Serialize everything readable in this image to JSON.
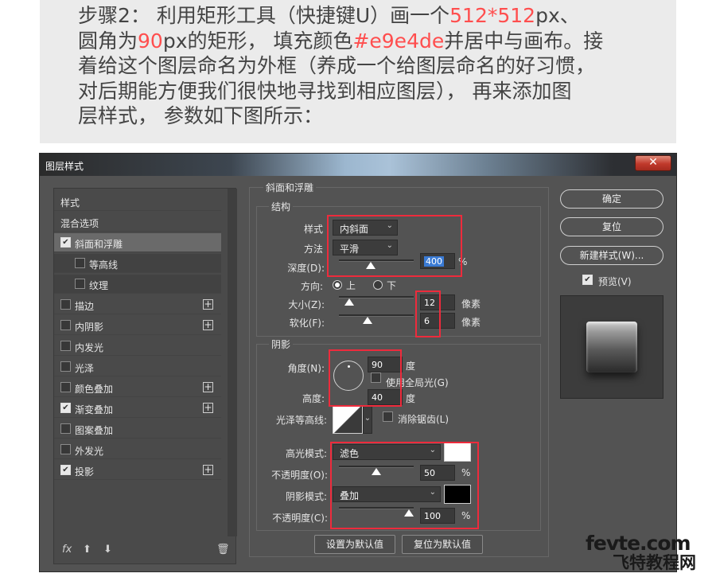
{
  "intro": {
    "line1_a": "步骤2：  利用矩形工具（快捷键U）画一个",
    "line1_hl": "512*512",
    "line1_b": "px、",
    "line2_a": "圆角为",
    "line2_hl1": "90",
    "line2_b": "px的矩形，  填充颜色",
    "line2_hl2": "#e9e4de",
    "line2_c": "并居中与画布。接",
    "line3": "着给这个图层命名为外框（养成一个给图层命名的好习惯，",
    "line4": "对后期能方便我们很快地寻找到相应图层），  再来添加图",
    "line5": "层样式，  参数如下图所示："
  },
  "dialog": {
    "title": "图层样式",
    "close_glyph": "✕"
  },
  "style_list": {
    "items": [
      {
        "label": "样式",
        "check": "",
        "plus": ""
      },
      {
        "label": "混合选项",
        "check": "",
        "plus": ""
      },
      {
        "label": "斜面和浮雕",
        "check": "✔",
        "plus": ""
      },
      {
        "label": "等高线",
        "check": "",
        "plus": ""
      },
      {
        "label": "纹理",
        "check": "",
        "plus": ""
      },
      {
        "label": "描边",
        "check": "",
        "plus": "+"
      },
      {
        "label": "内阴影",
        "check": "",
        "plus": "+"
      },
      {
        "label": "内发光",
        "check": "",
        "plus": ""
      },
      {
        "label": "光泽",
        "check": "",
        "plus": ""
      },
      {
        "label": "颜色叠加",
        "check": "",
        "plus": "+"
      },
      {
        "label": "渐变叠加",
        "check": "✔",
        "plus": "+"
      },
      {
        "label": "图案叠加",
        "check": "",
        "plus": ""
      },
      {
        "label": "外发光",
        "check": "",
        "plus": ""
      },
      {
        "label": "投影",
        "check": "✔",
        "plus": "+"
      }
    ],
    "fx": "fx",
    "up": "⬆",
    "down": "⬇",
    "trash": "🗑"
  },
  "bevel": {
    "group_title": "斜面和浮雕",
    "structure_title": "结构",
    "style_label": "样式",
    "style_value": "内斜面",
    "method_label": "方法",
    "method_value": "平滑",
    "depth_label": "深度(D):",
    "depth_value": "400",
    "depth_unit": "%",
    "depth_slider": 0.42,
    "direction_label": "方向:",
    "direction_up": "上",
    "direction_down": "下",
    "size_label": "大小(Z):",
    "size_value": "12",
    "size_unit": "像素",
    "size_slider": 0.08,
    "soften_label": "软化(F):",
    "soften_value": "6",
    "soften_unit": "像素",
    "soften_slider": 0.36
  },
  "shading": {
    "title": "阴影",
    "angle_label": "角度(N):",
    "angle_value": "90",
    "angle_unit": "度",
    "global_light_label": "使用全局光(G)",
    "altitude_label": "高度:",
    "altitude_value": "40",
    "altitude_unit": "度",
    "gloss_label": "光泽等高线:",
    "antialias_label": "消除锯齿(L)",
    "highlight_label": "高光模式:",
    "highlight_mode": "滤色",
    "highlight_color": "#ffffff",
    "highlight_opacity_label": "不透明度(O):",
    "highlight_opacity": "50",
    "highlight_opacity_slider": 0.5,
    "shadow_label": "阴影模式:",
    "shadow_mode": "叠加",
    "shadow_color": "#000000",
    "shadow_opacity_label": "不透明度(C):",
    "shadow_opacity": "100",
    "shadow_opacity_slider": 1.0,
    "percent": "%"
  },
  "footer": {
    "set_default": "设置为默认值",
    "reset_default": "复位为默认值"
  },
  "right": {
    "ok": "确定",
    "reset": "复位",
    "new_style": "新建样式(W)...",
    "preview_label": "预览(V)",
    "preview_check": "✔"
  },
  "watermark": {
    "line1": "fevte.com",
    "line2": "飞特教程网"
  },
  "colors": {
    "accent_red": "#ff4e4e",
    "annotation_red": "#ee2b3c",
    "dialog_bg": "#535353"
  }
}
